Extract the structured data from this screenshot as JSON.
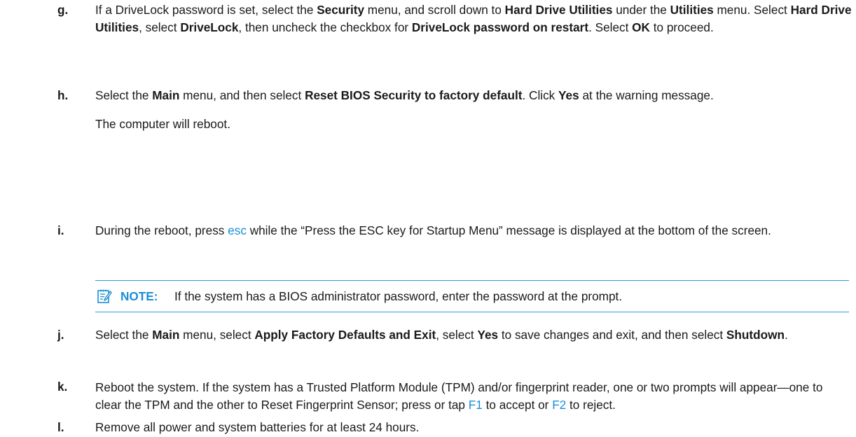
{
  "steps": {
    "g": {
      "marker": "g.",
      "t1": "If a DriveLock password is set, select the ",
      "b1": "Security",
      "t2": " menu, and scroll down to ",
      "b2": "Hard Drive Utilities",
      "t3": " under the ",
      "b3": "Utilities",
      "t4": " menu. Select ",
      "b4": "Hard Drive Utilities",
      "t5": ", select ",
      "b5": "DriveLock",
      "t6": ", then uncheck the checkbox for ",
      "b6": "DriveLock password on restart",
      "t7": ". Select ",
      "b7": "OK",
      "t8": " to proceed."
    },
    "h": {
      "marker": "h.",
      "t1": "Select the ",
      "b1": "Main",
      "t2": " menu, and then select ",
      "b2": "Reset BIOS Security to factory default",
      "t3": ". Click ",
      "b3": "Yes",
      "t4": " at the warning message.",
      "sub": "The computer will reboot."
    },
    "i": {
      "marker": "i.",
      "t1": "During the reboot, press ",
      "k1": "esc",
      "t2": " while the “Press the ESC key for Startup Menu” message is displayed at the bottom of the screen."
    },
    "j": {
      "marker": "j.",
      "t1": "Select the ",
      "b1": "Main",
      "t2": " menu, select ",
      "b2": "Apply Factory Defaults and Exit",
      "t3": ", select ",
      "b3": "Yes",
      "t4": " to save changes and exit, and then select ",
      "b4": "Shutdown",
      "t5": "."
    },
    "k": {
      "marker": "k.",
      "t1": "Reboot the system. If the system has a Trusted Platform Module (TPM) and/or fingerprint reader, one or two prompts will appear—one to clear the TPM and the other to Reset Fingerprint Sensor; press or tap ",
      "k1": "F1",
      "t2": " to accept or ",
      "k2": "F2",
      "t3": " to reject."
    },
    "l": {
      "marker": "l.",
      "t1": "Remove all power and system batteries for at least 24 hours."
    }
  },
  "note": {
    "icon": "note-pencil-icon",
    "label": "NOTE:",
    "text": "If the system has a BIOS administrator password, enter the password at the prompt."
  },
  "colors": {
    "accent": "#1a8fd6",
    "rule": "#2e9bd8",
    "text": "#1a1a1a"
  }
}
